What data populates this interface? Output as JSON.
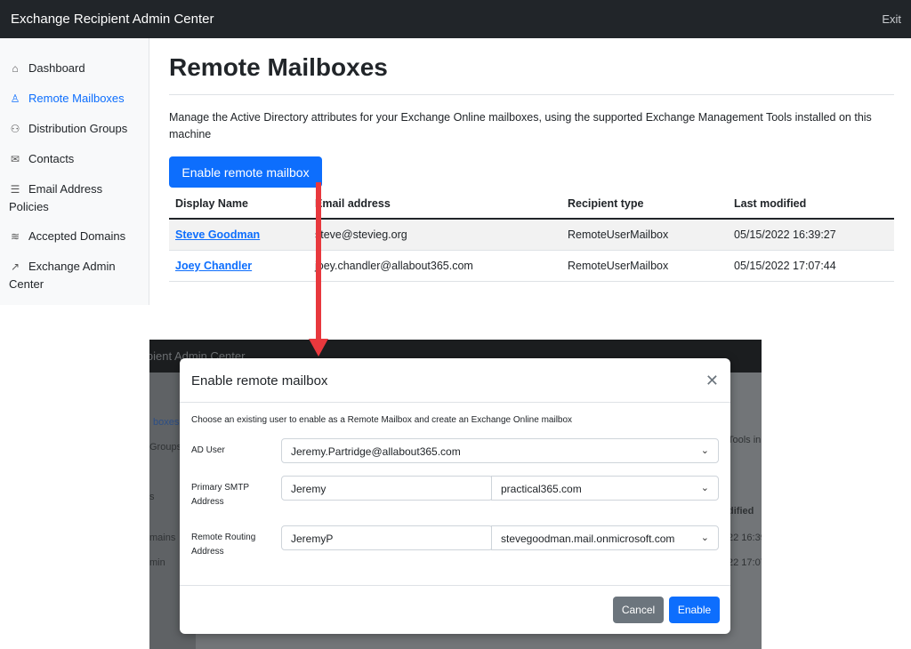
{
  "app": {
    "title": "Exchange Recipient Admin Center",
    "exit_label": "Exit"
  },
  "sidebar": {
    "items": [
      {
        "label": "Dashboard",
        "icon": "home-icon",
        "glyph": "⌂"
      },
      {
        "label": "Remote Mailboxes",
        "icon": "person-icon",
        "glyph": "♙"
      },
      {
        "label": "Distribution Groups",
        "icon": "people-icon",
        "glyph": "⚇"
      },
      {
        "label": "Contacts",
        "icon": "envelope-icon",
        "glyph": "✉"
      },
      {
        "label": "Email Address Policies",
        "icon": "list-icon",
        "glyph": "☰"
      },
      {
        "label": "Accepted Domains",
        "icon": "layers-icon",
        "glyph": "≋"
      },
      {
        "label": "Exchange Admin Center",
        "icon": "external-link-icon",
        "glyph": "↗"
      }
    ]
  },
  "main": {
    "title": "Remote Mailboxes",
    "description": "Manage the Active Directory attributes for your Exchange Online mailboxes, using the supported Exchange Management Tools installed on this machine",
    "enable_button": "Enable remote mailbox",
    "table": {
      "headers": [
        "Display Name",
        "Email address",
        "Recipient type",
        "Last modified"
      ],
      "rows": [
        [
          "Steve Goodman",
          "steve@stevieg.org",
          "RemoteUserMailbox",
          "05/15/2022 16:39:27"
        ],
        [
          "Joey Chandler",
          "joey.chandler@allabout365.com",
          "RemoteUserMailbox",
          "05/15/2022 17:07:44"
        ]
      ]
    }
  },
  "background": {
    "title_fragment": "ipient Admin Center",
    "nav_fragments": [
      "boxes",
      "Groups",
      "s",
      "mains",
      "min"
    ],
    "content_fragments": [
      "Tools in",
      "dified",
      "22 16:39",
      "22 17:07"
    ]
  },
  "modal": {
    "title": "Enable remote mailbox",
    "description": "Choose an existing user to enable as a Remote Mailbox and create an Exchange Online mailbox",
    "ad_user_label": "AD User",
    "ad_user_value": "Jeremy.Partridge@allabout365.com",
    "smtp_label_line1": "Primary SMTP",
    "smtp_label_line2": "Address",
    "smtp_alias": "Jeremy",
    "smtp_domain": "practical365.com",
    "routing_label_line1": "Remote Routing",
    "routing_label_line2": "Address",
    "routing_alias": "JeremyP",
    "routing_domain": "stevegoodman.mail.onmicrosoft.com",
    "cancel_label": "Cancel",
    "enable_label": "Enable"
  },
  "colors": {
    "accent": "#0d6efd",
    "topbar": "#212529",
    "arrow": "#e8383d",
    "secondary": "#6c757d"
  }
}
